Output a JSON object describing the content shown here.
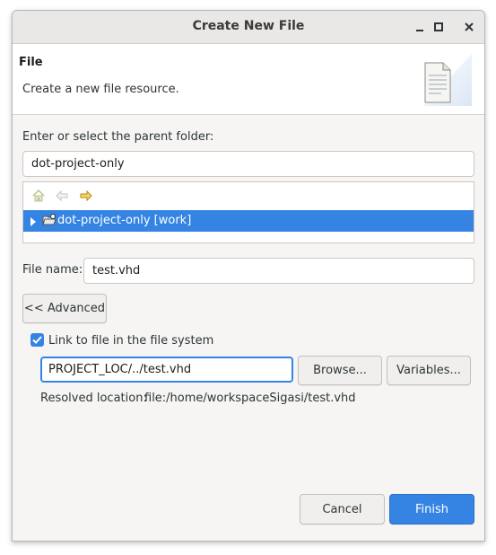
{
  "window": {
    "title": "Create New File"
  },
  "header": {
    "title": "File",
    "description": "Create a new file resource."
  },
  "parent_folder": {
    "label": "Enter or select the parent folder:",
    "value": "dot-project-only",
    "tree_items": [
      {
        "label": "dot-project-only [work]",
        "selected": true
      }
    ]
  },
  "file_name": {
    "label": "File name:",
    "value": "test.vhd"
  },
  "advanced": {
    "toggle_label": "<< Advanced",
    "link_checkbox_label": "Link to file in the file system",
    "link_checked": true,
    "link_value": "PROJECT_LOC/../test.vhd",
    "browse_label": "Browse...",
    "variables_label": "Variables...",
    "resolved_label": "Resolved location:",
    "resolved_value": "file:/home/workspaceSigasi/test.vhd"
  },
  "footer": {
    "cancel_label": "Cancel",
    "finish_label": "Finish"
  },
  "colors": {
    "accent": "#3584e4"
  },
  "icons": [
    "minimize-icon",
    "maximize-icon",
    "close-icon",
    "file-wizard-icon",
    "home-icon",
    "back-arrow-icon",
    "forward-arrow-icon",
    "expand-triangle-icon",
    "folder-icon",
    "checkmark-icon"
  ]
}
